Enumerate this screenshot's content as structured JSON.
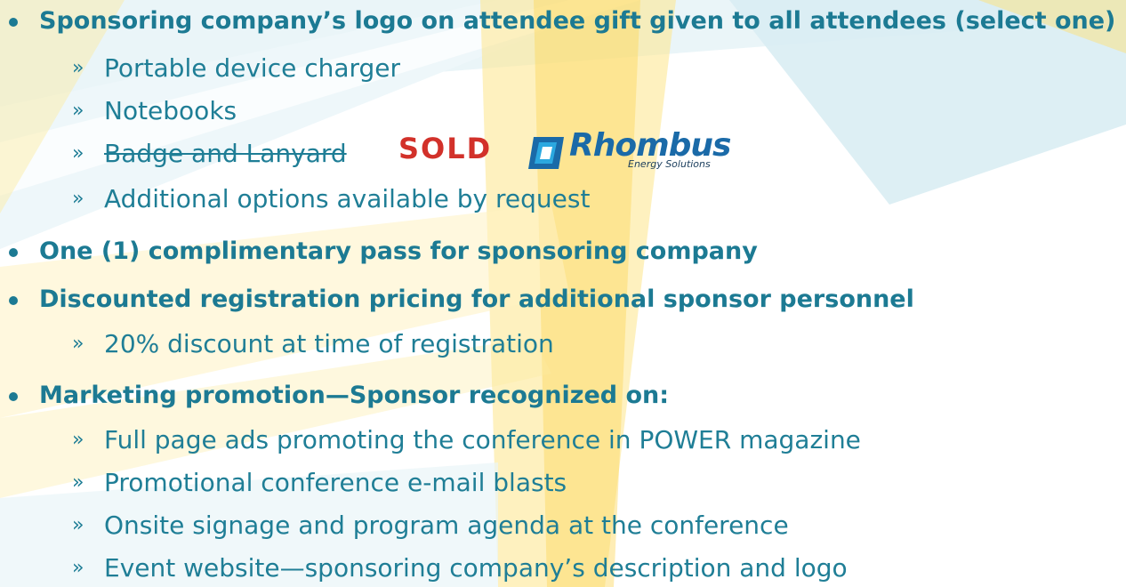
{
  "colors": {
    "text": "#1f7e96",
    "heading": "#1c7a93",
    "sold": "#d2312a",
    "logo_blue": "#1a6aa8",
    "logo_cyan": "#2ba8e0",
    "bg_yellow": "#fde27a",
    "bg_blue": "#d8ecf2"
  },
  "items": [
    {
      "label": "Sponsoring company’s logo on attendee gift given to all attendees (select one)",
      "subs": [
        "Portable device charger",
        "Notebooks",
        "Badge and Lanyard",
        "Additional options available by request"
      ]
    },
    {
      "label": "One (1) complimentary pass for sponsoring company"
    },
    {
      "label": "Discounted registration pricing for additional sponsor personnel",
      "subs": [
        "20% discount at time of registration"
      ]
    },
    {
      "label": "Marketing promotion—Sponsor recognized on:",
      "subs": [
        "Full page ads promoting the conference in POWER magazine",
        "Promotional conference e-mail blasts",
        "Onsite signage and program agenda at the conference",
        "Event website—sponsoring company’s description and logo"
      ]
    }
  ],
  "sub_marker": "»",
  "sold_label": "SOLD",
  "sponsor_logo": {
    "name": "Rhombus",
    "tagline": "Energy Solutions",
    "icon": "rhombus-logo-icon"
  }
}
